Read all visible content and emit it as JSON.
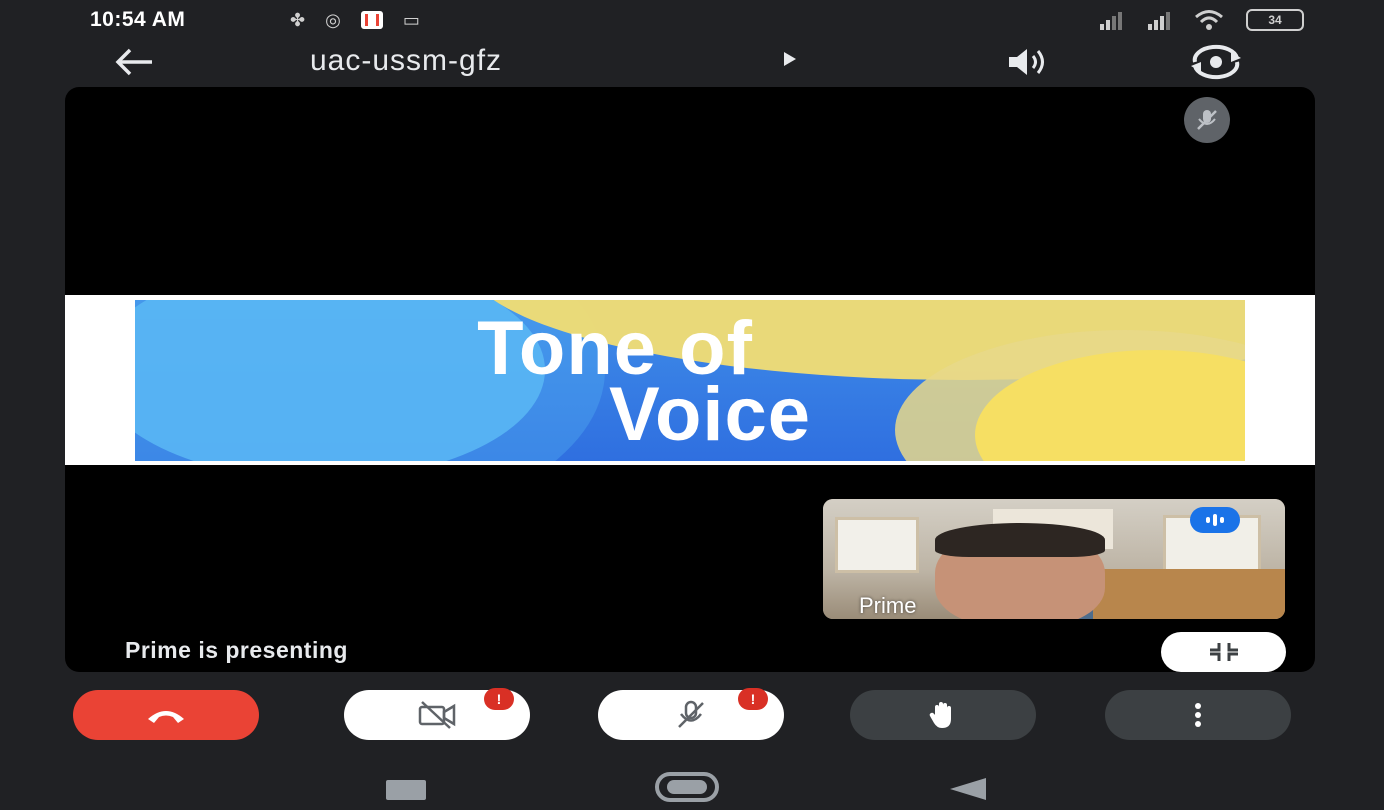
{
  "status_bar": {
    "time": "10:54 AM",
    "battery": "34"
  },
  "header": {
    "meeting_code": "uac-ussm-gfz"
  },
  "slide": {
    "title_line1": "Tone of",
    "title_line2": "Voice"
  },
  "participant_tile": {
    "name": "Prime"
  },
  "stage": {
    "presenting_label": "Prime is presenting"
  },
  "controls": {
    "camera_alert": "!",
    "mic_alert": "!"
  },
  "colors": {
    "end_call": "#ea4335",
    "alert": "#d93025",
    "speaking_indicator": "#1a73e8",
    "background": "#202124"
  },
  "icons": [
    "back-arrow-icon",
    "speaker-icon",
    "switch-camera-icon",
    "mic-off-icon",
    "end-call-icon",
    "camera-off-icon",
    "raise-hand-icon",
    "more-options-icon",
    "collapse-icon",
    "audio-level-icon"
  ]
}
